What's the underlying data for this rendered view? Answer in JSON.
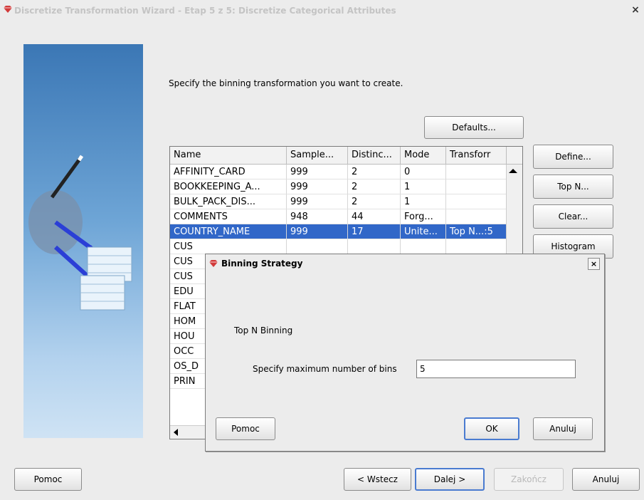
{
  "window": {
    "title": "Discretize Transformation Wizard - Etap 5 z 5: Discretize Categorical Attributes",
    "close_label": "×"
  },
  "main": {
    "instruction": "Specify the binning transformation you want to create.",
    "defaults_label": "Defaults...",
    "table": {
      "columns": [
        "Name",
        "Sample...",
        "Distinc...",
        "Mode",
        "Transforr"
      ],
      "rows": [
        [
          "AFFINITY_CARD",
          "999",
          "2",
          "0",
          ""
        ],
        [
          "BOOKKEEPING_A...",
          "999",
          "2",
          "1",
          ""
        ],
        [
          "BULK_PACK_DIS...",
          "999",
          "2",
          "1",
          ""
        ],
        [
          "COMMENTS",
          "948",
          "44",
          "Forg...",
          ""
        ],
        [
          "COUNTRY_NAME",
          "999",
          "17",
          "Unite...",
          "Top N...:5"
        ],
        [
          "CUS",
          "",
          "",
          "",
          ""
        ],
        [
          "CUS",
          "",
          "",
          "",
          ""
        ],
        [
          "CUS",
          "",
          "",
          "",
          ""
        ],
        [
          "EDU",
          "",
          "",
          "",
          ""
        ],
        [
          "FLAT",
          "",
          "",
          "",
          ""
        ],
        [
          "HOM",
          "",
          "",
          "",
          ""
        ],
        [
          "HOU",
          "",
          "",
          "",
          ""
        ],
        [
          "OCC",
          "",
          "",
          "",
          ""
        ],
        [
          "OS_D",
          "",
          "",
          "",
          ""
        ],
        [
          "PRIN",
          "",
          "",
          "",
          ""
        ]
      ],
      "selected_row": 4
    },
    "side_buttons": {
      "define": "Define...",
      "topn": "Top N...",
      "clear": "Clear...",
      "histogram": "Histogram"
    }
  },
  "footer": {
    "help": "Pomoc",
    "back": "< Wstecz",
    "next": "Dalej >",
    "finish": "Zakończ",
    "cancel": "Anuluj"
  },
  "dialog": {
    "title": "Binning Strategy",
    "close_label": "×",
    "heading": "Top N Binning",
    "field_label": "Specify maximum number of bins",
    "field_value": "5",
    "help": "Pomoc",
    "ok": "OK",
    "cancel": "Anuluj"
  },
  "colors": {
    "selection": "#3167c8",
    "side_panel": "#3b77b5"
  }
}
